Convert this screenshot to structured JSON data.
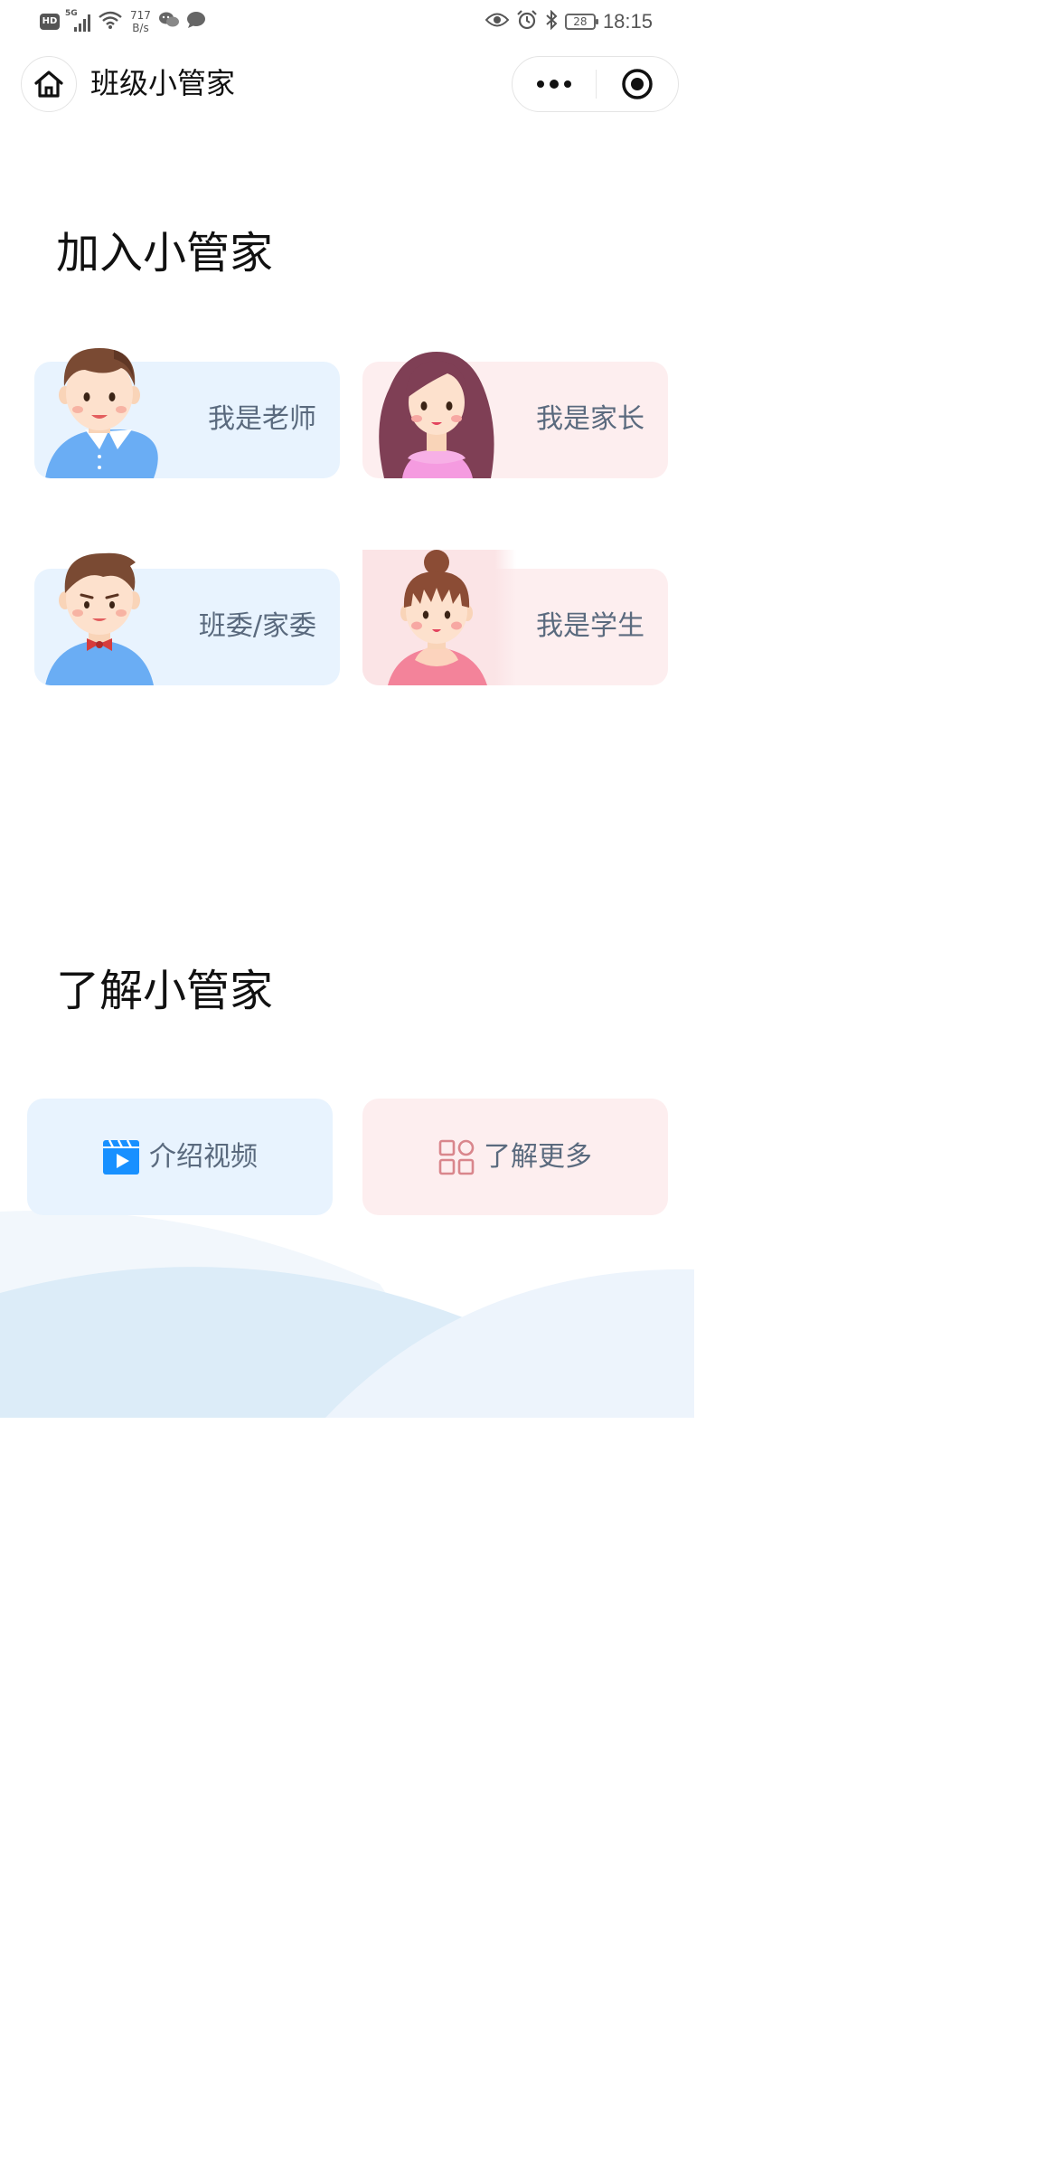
{
  "status_bar": {
    "hd": "HD",
    "network": "5G",
    "speed_value": "717",
    "speed_unit": "B/s",
    "battery": "28",
    "time": "18:15"
  },
  "nav": {
    "title": "班级小管家"
  },
  "join_section": {
    "title": "加入小管家",
    "cards": [
      {
        "label": "我是老师",
        "theme": "#e8f3fe"
      },
      {
        "label": "我是家长",
        "theme": "#fdeeef"
      },
      {
        "label": "班委/家委",
        "theme": "#e8f3fe"
      },
      {
        "label": "我是学生",
        "theme": "#fdeeef"
      }
    ]
  },
  "learn_section": {
    "title": "了解小管家",
    "buttons": [
      {
        "label": "介绍视频",
        "icon": "video-icon",
        "icon_color": "#1890ff"
      },
      {
        "label": "了解更多",
        "icon": "grid-icon",
        "icon_color": "#d9868c"
      }
    ]
  },
  "colors": {
    "label_text": "#5a6a7e",
    "card_blue": "#e8f3fe",
    "card_pink": "#fdeeef"
  }
}
